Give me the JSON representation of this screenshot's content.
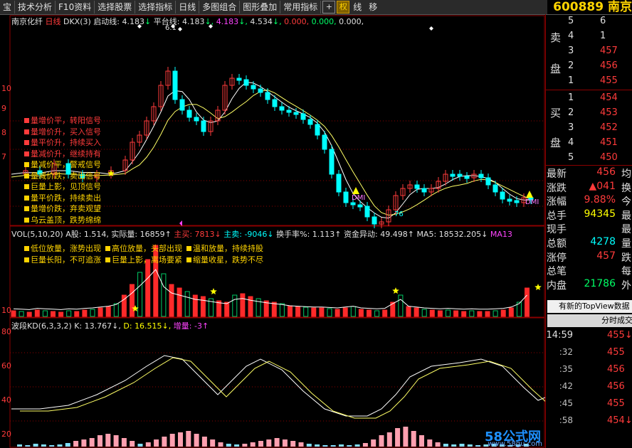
{
  "toolbar": {
    "items": [
      "宝",
      "技术分析",
      "F10资料",
      "选择股票",
      "选择指标",
      "日线",
      "多图组合",
      "图形叠加",
      "常用指标"
    ],
    "toggles": [
      "权",
      "线",
      "移"
    ],
    "stock_code": "600889 南京"
  },
  "main_header": {
    "name": "南京化纤",
    "period": "日线",
    "indicator": "DKX(3)",
    "start_label": "启动线:",
    "start_val": "4.183",
    "flat_label": "平台线:",
    "flat_val": "4.183",
    "vals": [
      "4.183",
      "4.534",
      "0.000,",
      "0.000,",
      "0.000,"
    ],
    "peak_label": "6.1"
  },
  "signals": [
    {
      "text": "量增价平，转阳信号",
      "color": "#ff3b3b"
    },
    {
      "text": "量增价升，买入信号",
      "color": "#ff3b3b"
    },
    {
      "text": "量平价升，持续买入",
      "color": "#ff3b3b"
    },
    {
      "text": "量减价升，继续持有",
      "color": "#ff3b3b"
    },
    {
      "text": "量减价平，警戒信号",
      "color": "#ffd400"
    },
    {
      "text": "量减价跌，卖出信号",
      "color": "#ffd400"
    },
    {
      "text": "巨量上影，见顶信号",
      "color": "#ffd400"
    },
    {
      "text": "量平价跌，持续卖出",
      "color": "#ffd400"
    },
    {
      "text": "量增价跌，弃卖观望",
      "color": "#ffd400"
    },
    {
      "text": "乌云盖顶，跌势绵绵",
      "color": "#ffd400"
    }
  ],
  "main_marks": {
    "dmi": "DMI",
    "low_label": "76"
  },
  "vol_header": {
    "title": "VOL(5,10,20)",
    "a_label": "A股: 1.514,",
    "actual": "实际量: 16859↑",
    "buy": "主买: 7813↓",
    "sell": "主卖: -9046↓",
    "turnover": "换手率%: 1.113↑",
    "abnormal": "资金异动: 49.498↑",
    "ma5": "MA5: 18532.205↓",
    "ma13": "MA13"
  },
  "vol_legend": [
    {
      "text": "低位放量，涨势出现",
      "color": "#ffd400"
    },
    {
      "text": "高位放量，头部出现",
      "color": "#ffd400"
    },
    {
      "text": "温和放量，持续持股",
      "color": "#ffd400"
    },
    {
      "text": "巨量长阳，不可追涨",
      "color": "#ffd400"
    },
    {
      "text": "巨量上影，离场要紧",
      "color": "#ffd400"
    },
    {
      "text": "缩量收星，跌势不尽",
      "color": "#ffd400"
    }
  ],
  "kd_header": {
    "title": "波段KD(6,3,3,2)",
    "k": "K: 13.767↓,",
    "d": "D: 16.515↓,",
    "inc": "增量: -3↑"
  },
  "left_axis": [
    "10",
    "9",
    "8",
    "7",
    "10",
    "80",
    "60",
    "40",
    "20"
  ],
  "order_book": {
    "sell_label": [
      "卖",
      "盘"
    ],
    "buy_label": [
      "买",
      "盘"
    ],
    "asks": [
      {
        "level": "5",
        "price": "",
        "vol": "6"
      },
      {
        "level": "4",
        "price": "",
        "vol": "1"
      },
      {
        "level": "3",
        "price": "",
        "vol": "457"
      },
      {
        "level": "2",
        "price": "",
        "vol": "456"
      },
      {
        "level": "1",
        "price": "",
        "vol": "455"
      }
    ],
    "bids": [
      {
        "level": "1",
        "price": "",
        "vol": "454"
      },
      {
        "level": "2",
        "price": "",
        "vol": "453"
      },
      {
        "level": "3",
        "price": "",
        "vol": "452"
      },
      {
        "level": "4",
        "price": "",
        "vol": "451"
      },
      {
        "level": "5",
        "price": "",
        "vol": "450"
      }
    ]
  },
  "stats": [
    {
      "k": "最新",
      "v": "456",
      "c": "均",
      "color": "#ff3b3b"
    },
    {
      "k": "涨跌",
      "v": "▲041",
      "c": "换",
      "color": "#ff3b3b"
    },
    {
      "k": "涨幅",
      "v": "9.88%",
      "c": "今",
      "color": "#ff3b3b"
    },
    {
      "k": "总手",
      "v": "94345",
      "c": "最",
      "color": "#ffff00"
    },
    {
      "k": "现手",
      "v": "",
      "c": "最",
      "color": "#ffff00"
    },
    {
      "k": "总额",
      "v": "4278",
      "c": "量",
      "color": "#00ffff"
    },
    {
      "k": "涨停",
      "v": "457",
      "c": "跌",
      "color": "#ff3b3b"
    },
    {
      "k": "总笔",
      "v": "",
      "c": "每",
      "color": "#e0e0e0"
    },
    {
      "k": "内盘",
      "v": "21786",
      "c": "外",
      "color": "#00ff66"
    }
  ],
  "topview": {
    "notice": "有新的TopView数据",
    "tab": "分时成交"
  },
  "ticks": [
    {
      "t": "14:59",
      "p": "455",
      "arrow": "↓"
    },
    {
      "t": ":32",
      "p": "455",
      "arrow": ""
    },
    {
      "t": ":35",
      "p": "456",
      "arrow": ""
    },
    {
      "t": ":42",
      "p": "456",
      "arrow": ""
    },
    {
      "t": ":45",
      "p": "455",
      "arrow": ""
    },
    {
      "t": ":58",
      "p": "454",
      "arrow": "↓"
    }
  ],
  "watermark": {
    "brand": "58公式网",
    "url": "www.58gu.com"
  },
  "colors": {
    "up": "#ff3b3b",
    "down": "#00ffff",
    "ma_white": "#ffffff",
    "ma_yellow": "#ffff66",
    "accent": "#ffd400"
  }
}
